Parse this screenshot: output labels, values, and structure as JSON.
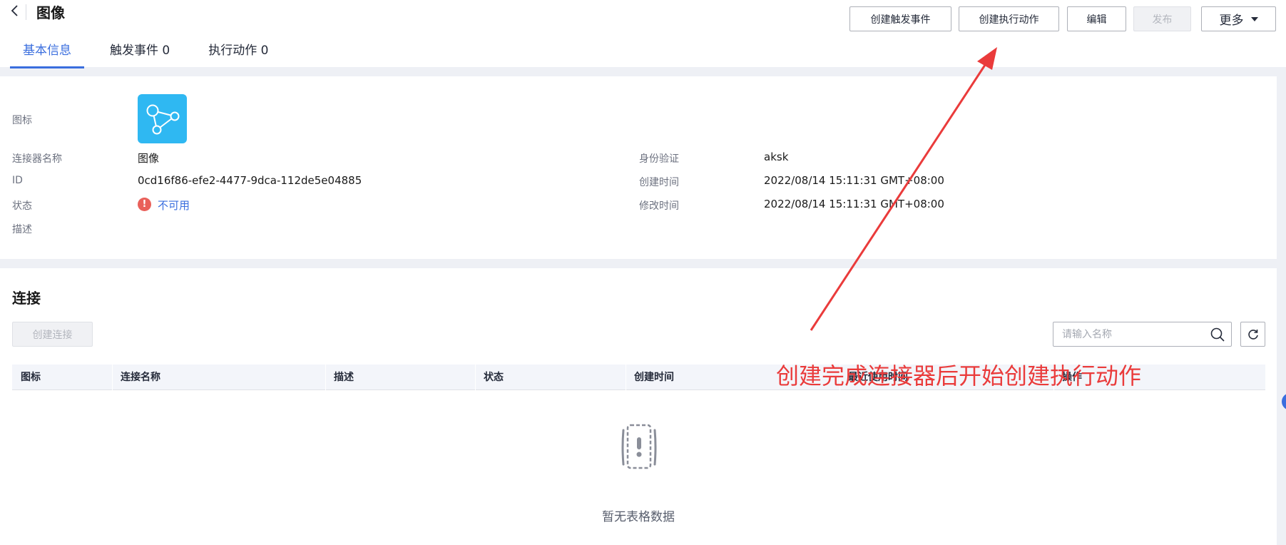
{
  "header": {
    "title": "图像",
    "tabs": [
      {
        "label": "基本信息",
        "active": true
      },
      {
        "label": "触发事件 0",
        "active": false
      },
      {
        "label": "执行动作 0",
        "active": false
      }
    ],
    "buttons": {
      "create_trigger": "创建触发事件",
      "create_action": "创建执行动作",
      "edit": "编辑",
      "publish": "发布",
      "more": "更多"
    }
  },
  "basic_info": {
    "icon_label": "图标",
    "name_label": "连接器名称",
    "name_value": "图像",
    "id_label": "ID",
    "id_value": "0cd16f86-efe2-4477-9dca-112de5e04885",
    "status_label": "状态",
    "status_value": "不可用",
    "desc_label": "描述",
    "auth_label": "身份验证",
    "auth_value": "aksk",
    "created_label": "创建时间",
    "created_value": "2022/08/14 15:11:31 GMT+08:00",
    "modified_label": "修改时间",
    "modified_value": "2022/08/14 15:11:31 GMT+08:00"
  },
  "connections": {
    "title": "连接",
    "create_button": "创建连接",
    "search_placeholder": "请输入名称",
    "columns": [
      "图标",
      "连接名称",
      "描述",
      "状态",
      "创建时间",
      "最近使用时间",
      "操作"
    ],
    "empty_text": "暂无表格数据"
  },
  "annotation": {
    "text": "创建完成连接器后开始创建执行动作",
    "color": "#ea3b3b"
  },
  "colors": {
    "accent": "#3a6ede",
    "connector_icon_bg": "#2fb8f2",
    "error": "#e9605a"
  }
}
